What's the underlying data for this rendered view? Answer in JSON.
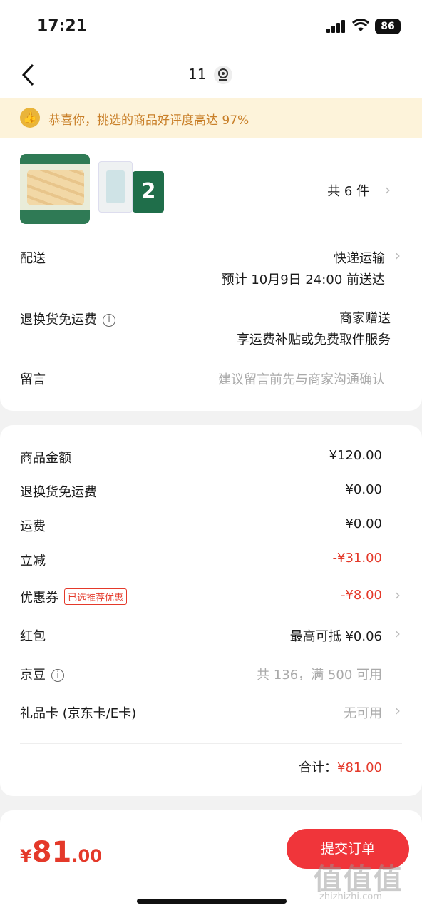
{
  "status": {
    "time": "17:21",
    "battery": "86"
  },
  "nav": {
    "title": "11"
  },
  "banner": {
    "text": "恭喜你，挑选的商品好评度高达 97%"
  },
  "products": {
    "count_text": "共 6 件"
  },
  "delivery": {
    "label": "配送",
    "method": "快递运输",
    "eta": "预计 10月9日 24:00 前送达"
  },
  "return_fee": {
    "label": "退换货免运费",
    "value": "商家赠送",
    "desc": "享运费补贴或免费取件服务"
  },
  "message": {
    "label": "留言",
    "placeholder": "建议留言前先与商家沟通确认"
  },
  "price": {
    "rows": [
      {
        "label": "商品金额",
        "value": "¥120.00"
      },
      {
        "label": "退换货免运费",
        "value": "¥0.00"
      },
      {
        "label": "运费",
        "value": "¥0.00"
      },
      {
        "label": "立减",
        "value": "-¥31.00"
      },
      {
        "label": "优惠券",
        "tag": "已选推荐优惠",
        "value": "-¥8.00"
      },
      {
        "label": "红包",
        "value": "最高可抵 ¥0.06"
      },
      {
        "label": "京豆",
        "value": "共 136，满 500 可用"
      },
      {
        "label": "礼品卡 (京东卡/E卡)",
        "value": "无可用"
      }
    ],
    "total_label": "合计：",
    "total_value": "¥81.00"
  },
  "footer": {
    "currency": "¥",
    "total_int": "81",
    "total_dec": ".00",
    "submit_label": "提交订单"
  },
  "watermark": {
    "text": "zhizhizhi.com",
    "logo": "值值值"
  },
  "colors": {
    "accent": "#e4392a",
    "button": "#f0353a",
    "banner_bg": "#fdf3da",
    "banner_text": "#c9802a"
  }
}
